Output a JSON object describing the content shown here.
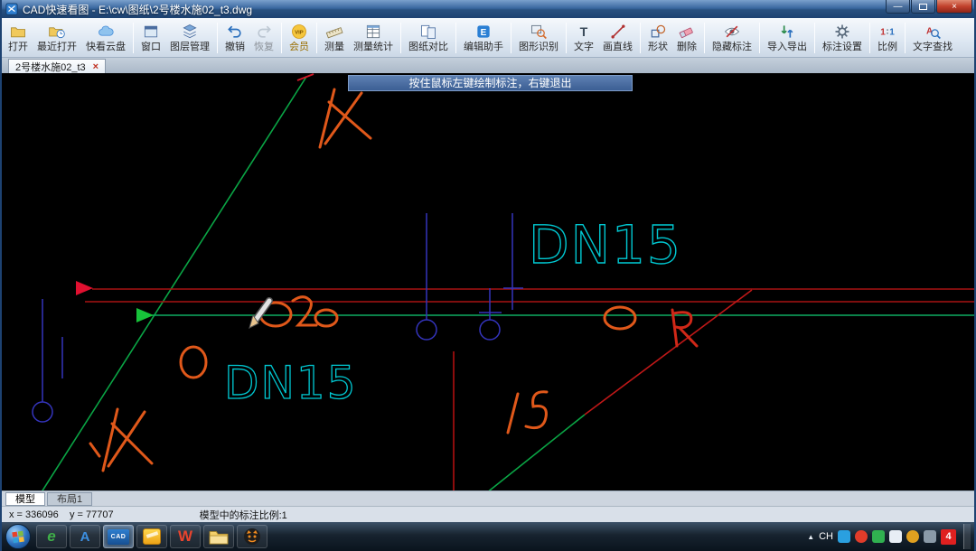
{
  "window": {
    "title": "CAD快速看图 - E:\\cw\\图纸\\2号楼水施02_t3.dwg",
    "controls": {
      "minimize": "—",
      "close": "×"
    }
  },
  "toolbar": {
    "items": [
      {
        "label": "打开"
      },
      {
        "label": "最近打开"
      },
      {
        "label": "快看云盘"
      },
      {
        "label": "窗口"
      },
      {
        "label": "图层管理"
      },
      {
        "label": "撤销"
      },
      {
        "label": "恢复"
      },
      {
        "label": "会员",
        "badge": "VIP"
      },
      {
        "label": "测量"
      },
      {
        "label": "测量统计"
      },
      {
        "label": "图纸对比"
      },
      {
        "label": "编辑助手"
      },
      {
        "label": "图形识别"
      },
      {
        "label": "文字"
      },
      {
        "label": "画直线"
      },
      {
        "label": "形状"
      },
      {
        "label": "删除"
      },
      {
        "label": "隐藏标注"
      },
      {
        "label": "导入导出"
      },
      {
        "label": "标注设置"
      },
      {
        "label": "比例"
      },
      {
        "label": "文字查找"
      }
    ]
  },
  "doc_tabs": [
    {
      "label": "2号楼水施02_t3",
      "close": "×"
    }
  ],
  "canvas": {
    "hint": "按住鼠标左键绘制标注，右键退出",
    "labels": [
      {
        "text": "DN15"
      },
      {
        "text": "DN15"
      }
    ],
    "colors": {
      "pipe_green": "#0aa545",
      "pipe_red": "#b41414",
      "pipe_blue": "#3434bc",
      "label_cyan": "#00c8d2",
      "sketch_orange": "#e0581a"
    }
  },
  "sheet_tabs": [
    {
      "label": "模型"
    },
    {
      "label": "布局1"
    }
  ],
  "statusbar": {
    "coordinates": "x = 336096    y = 77707",
    "scale_note": "模型中的标注比例:1"
  },
  "taskbar": {
    "apps": [
      {
        "label": "e"
      },
      {
        "label": "A"
      },
      {
        "label": "CAD"
      },
      {
        "label": "W"
      }
    ],
    "tray": {
      "expand": "▲",
      "language": "CH",
      "badge": "4"
    }
  }
}
